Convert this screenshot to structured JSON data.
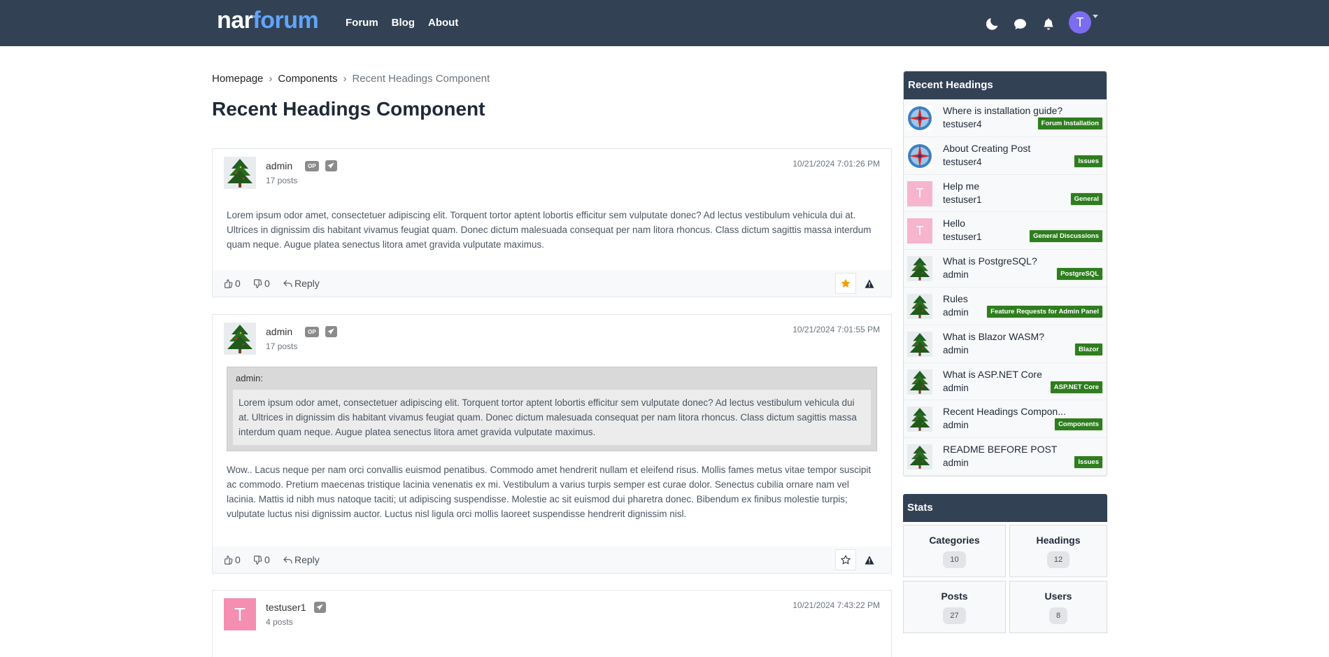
{
  "nav": {
    "brand_part1": "nar",
    "brand_part2": "forum",
    "links": [
      "Forum",
      "Blog",
      "About"
    ],
    "avatar_letter": "T"
  },
  "breadcrumb": {
    "items": [
      "Homepage",
      "Components",
      "Recent Headings Component"
    ],
    "separator": "›"
  },
  "page_title": "Recent Headings Component",
  "posts": [
    {
      "user": "admin",
      "op_badge": "OP",
      "posts_count": "17 posts",
      "date": "10/21/2024 7:01:26 PM",
      "body": "Lorem ipsum odor amet, consectetuer adipiscing elit. Torquent tortor aptent lobortis efficitur sem vulputate donec? Ad lectus vestibulum vehicula dui at. Ultrices in dignissim dis habitant vivamus feugiat quam. Donec dictum malesuada consequat per nam litora rhoncus. Class dictum sagittis massa interdum quam neque. Augue platea senectus litora amet gravida vulputate maximus.",
      "likes": "0",
      "dislikes": "0",
      "reply_label": "Reply"
    },
    {
      "user": "admin",
      "op_badge": "OP",
      "posts_count": "17 posts",
      "date": "10/21/2024 7:01:55 PM",
      "quote_author": "admin:",
      "quote_body": "Lorem ipsum odor amet, consectetuer adipiscing elit. Torquent tortor aptent lobortis efficitur sem vulputate donec? Ad lectus vestibulum vehicula dui at. Ultrices in dignissim dis habitant vivamus feugiat quam. Donec dictum malesuada consequat per nam litora rhoncus. Class dictum sagittis massa interdum quam neque. Augue platea senectus litora amet gravida vulputate maximus.",
      "body": "Wow.. Lacus neque per nam orci convallis euismod penatibus. Commodo amet hendrerit nullam et eleifend risus. Mollis fames metus vitae tempor suscipit ac commodo. Pretium maecenas tristique lacinia venenatis ex mi. Vestibulum a varius turpis semper est curae dolor. Senectus cubilia ornare nam vel lacinia. Mattis id nibh mus natoque taciti; ut adipiscing suspendisse. Molestie ac sit euismod dui pharetra donec. Bibendum ex finibus molestie turpis; vulputate luctus nisi dignissim auctor. Luctus nisl ligula orci mollis laoreet suspendisse hendrerit dignissim nisl.",
      "likes": "0",
      "dislikes": "0",
      "reply_label": "Reply"
    },
    {
      "user": "testuser1",
      "avatar_letter": "T",
      "posts_count": "4 posts",
      "date": "10/21/2024 7:43:22 PM"
    }
  ],
  "recent_headings": {
    "title": "Recent Headings",
    "items": [
      {
        "title": "Where is installation guide?",
        "user": "testuser4",
        "tag": "Forum Installation",
        "avatar": "compass"
      },
      {
        "title": "About Creating Post",
        "user": "testuser4",
        "tag": "Issues",
        "avatar": "compass"
      },
      {
        "title": "Help me",
        "user": "testuser1",
        "tag": "General",
        "avatar": "letter",
        "letter": "T"
      },
      {
        "title": "Hello",
        "user": "testuser1",
        "tag": "General Discussions",
        "avatar": "letter",
        "letter": "T"
      },
      {
        "title": "What is PostgreSQL?",
        "user": "admin",
        "tag": "PostgreSQL",
        "avatar": "tree"
      },
      {
        "title": "Rules",
        "user": "admin",
        "tag": "Feature Requests for Admin Panel",
        "avatar": "tree"
      },
      {
        "title": "What is Blazor WASM?",
        "user": "admin",
        "tag": "Blazor",
        "avatar": "tree"
      },
      {
        "title": "What is ASP.NET Core",
        "user": "admin",
        "tag": "ASP.NET Core",
        "avatar": "tree"
      },
      {
        "title": "Recent Headings Compon...",
        "user": "admin",
        "tag": "Components",
        "avatar": "tree"
      },
      {
        "title": "README BEFORE POST",
        "user": "admin",
        "tag": "Issues",
        "avatar": "tree"
      }
    ]
  },
  "stats": {
    "title": "Stats",
    "items": [
      {
        "label": "Categories",
        "value": "10"
      },
      {
        "label": "Headings",
        "value": "12"
      },
      {
        "label": "Posts",
        "value": "27"
      },
      {
        "label": "Users",
        "value": "8"
      }
    ]
  }
}
